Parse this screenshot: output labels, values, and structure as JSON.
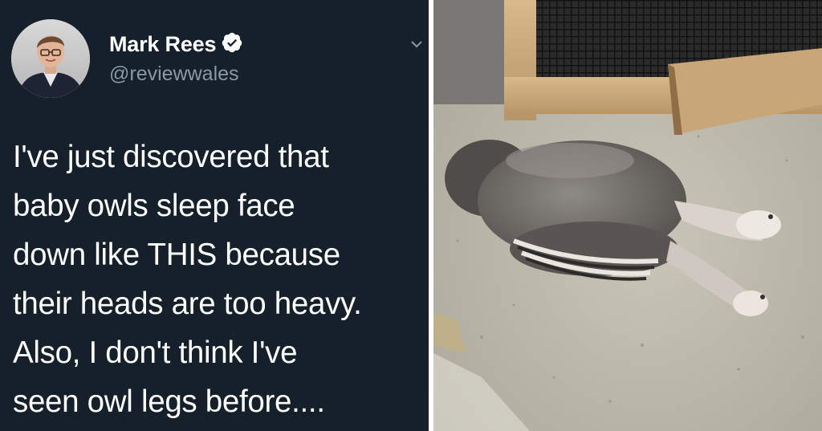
{
  "tweet": {
    "display_name": "Mark Rees",
    "handle": "@reviewwales",
    "verified_icon": "verified-badge-icon",
    "menu_icon": "chevron-down-icon",
    "text_lines": [
      "I've just discovered that",
      "baby owls sleep face",
      "down like THIS because",
      "their heads are too heavy.",
      "Also, I don't think I've",
      "seen owl legs before...."
    ]
  },
  "colors": {
    "tweet_background": "#15202b",
    "text_primary": "#ffffff",
    "text_secondary": "#8899a6"
  },
  "photo": {
    "subject": "baby-owl-sleeping-face-down-photo"
  }
}
